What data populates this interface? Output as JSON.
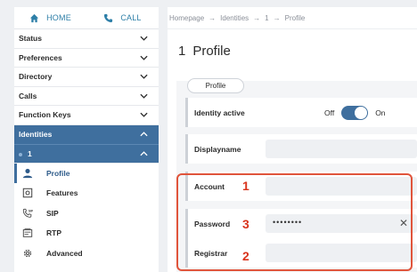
{
  "topbar": {
    "home_label": "HOME",
    "call_label": "CALL"
  },
  "sidebar": {
    "items": [
      {
        "label": "Status"
      },
      {
        "label": "Preferences"
      },
      {
        "label": "Directory"
      },
      {
        "label": "Calls"
      },
      {
        "label": "Function Keys"
      }
    ],
    "active": {
      "label": "Identities"
    },
    "sub": {
      "label": "1"
    },
    "children": [
      {
        "label": "Profile",
        "icon": "person-icon"
      },
      {
        "label": "Features",
        "icon": "features-icon"
      },
      {
        "label": "SIP",
        "icon": "sip-phone-icon"
      },
      {
        "label": "RTP",
        "icon": "rtp-icon"
      },
      {
        "label": "Advanced",
        "icon": "gear-icon"
      }
    ]
  },
  "breadcrumb": {
    "home": "Homepage",
    "identities": "Identities",
    "id": "1",
    "profile": "Profile",
    "sep": "→"
  },
  "page": {
    "number": "1",
    "title": "Profile",
    "tab": "Profile"
  },
  "form": {
    "identity_active": {
      "label": "Identity active",
      "off": "Off",
      "on": "On"
    },
    "displayname": {
      "label": "Displayname",
      "value": ""
    },
    "account": {
      "label": "Account",
      "value": ""
    },
    "password": {
      "label": "Password",
      "value": "••••••••"
    },
    "registrar": {
      "label": "Registrar",
      "value": ""
    }
  },
  "markers": {
    "account": "1",
    "registrar": "2",
    "password": "3"
  },
  "colors": {
    "accent": "#3f6f9e",
    "link": "#2e7fa8",
    "highlight": "#e0543b"
  }
}
